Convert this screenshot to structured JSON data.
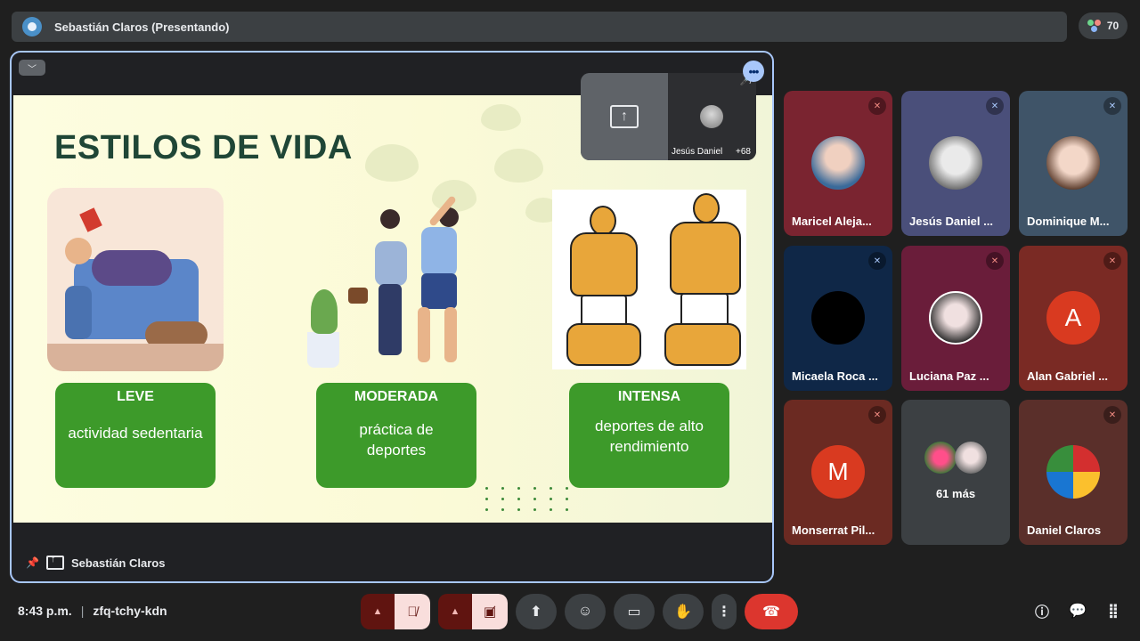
{
  "topbar": {
    "presenter": "Sebastián Claros (Presentando)"
  },
  "participants_count": "70",
  "slide": {
    "title": "ESTILOS DE VIDA",
    "cards": [
      {
        "title": "LEVE",
        "body": "actividad sedentaria"
      },
      {
        "title": "MODERADA",
        "body": "práctica de deportes"
      },
      {
        "title": "INTENSA",
        "body": "deportes de alto rendimiento"
      }
    ]
  },
  "presenter_bar": {
    "name": "Sebastián Claros"
  },
  "float_panel": {
    "name": "Jesús Daniel",
    "count": "+68"
  },
  "tiles": [
    {
      "name": "Maricel Aleja...",
      "bg": "#7a2430"
    },
    {
      "name": "Jesús Daniel ...",
      "bg": "#4a4f7a"
    },
    {
      "name": "Dominique M...",
      "bg": "#3f5468"
    },
    {
      "name": "Micaela Roca ...",
      "bg": "#0f2747"
    },
    {
      "name": "Luciana Paz ...",
      "bg": "#6a1d3a"
    },
    {
      "name": "Alan Gabriel ...",
      "bg": "#7a2a24",
      "initial": "A"
    },
    {
      "name": "Monserrat Pil...",
      "bg": "#6b2a22",
      "initial": "M"
    },
    {
      "more": "61 más",
      "bg": "#3c4043"
    },
    {
      "name": "Daniel Claros",
      "bg": "#5a2f2a"
    }
  ],
  "footer": {
    "time": "8:43 p.m.",
    "meeting_code": "zfq-tchy-kdn"
  }
}
